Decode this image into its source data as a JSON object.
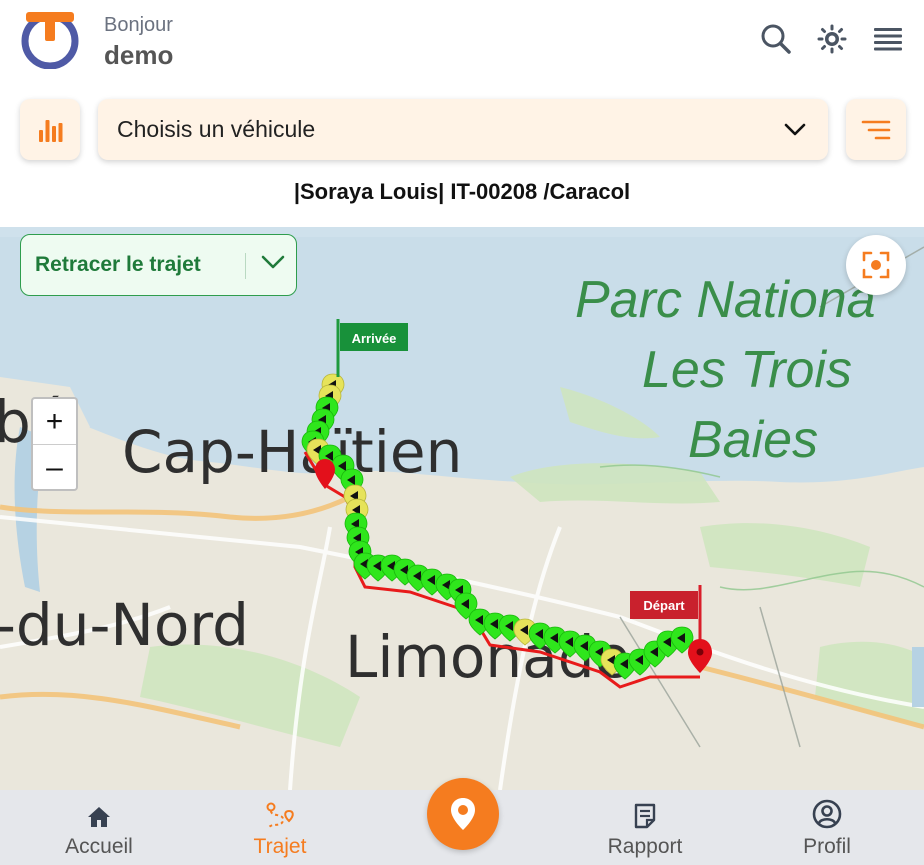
{
  "header": {
    "greeting": "Bonjour",
    "username": "demo",
    "icons": [
      "search-icon",
      "brightness-icon",
      "menu-icon"
    ]
  },
  "controls": {
    "stats_icon": "bar-chart-icon",
    "vehicle_select_placeholder": "Choisis un véhicule",
    "filter_icon": "filter-lines-icon"
  },
  "vehicle_info": "|Soraya Louis| IT-00208 /Caracol",
  "map": {
    "retrace_label": "Retracer le trajet",
    "zoom_in": "+",
    "zoom_out": "–",
    "labels": {
      "park_line1": "Parc Nationa",
      "park_line2": "Les Trois",
      "park_line3": "Baies",
      "city1": "Cap-Haïtien",
      "city2": "Limonade",
      "region": "-du-Nord",
      "left_edge": "bé"
    },
    "markers": {
      "arrival": "Arrivée",
      "departure": "Départ"
    }
  },
  "bottom_nav": {
    "items": [
      {
        "label": "Accueil",
        "icon": "home-icon"
      },
      {
        "label": "Trajet",
        "icon": "route-icon"
      },
      {
        "label": "Rapport",
        "icon": "report-icon"
      },
      {
        "label": "Profil",
        "icon": "profile-icon"
      }
    ],
    "fab_icon": "location-pin-icon"
  },
  "colors": {
    "accent": "#f57c1f",
    "green": "#1f7a3a",
    "route_green": "#22e000",
    "route_red": "#e81b1b",
    "card_bg": "#fff3e6"
  }
}
